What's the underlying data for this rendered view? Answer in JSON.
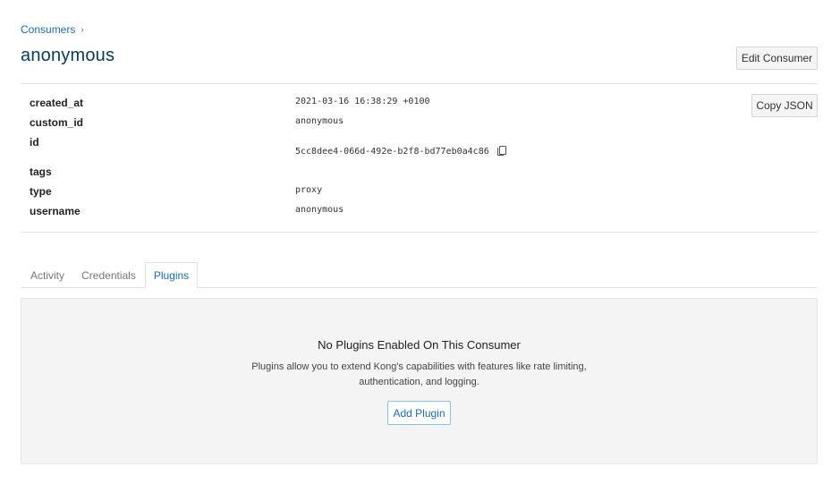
{
  "breadcrumb": {
    "parent": "Consumers",
    "separator": "›"
  },
  "title": "anonymous",
  "actions": {
    "edit_label": "Edit Consumer",
    "copy_json_label": "Copy JSON"
  },
  "details": [
    {
      "key": "created_at",
      "value": "2021-03-16 16:38:29 +0100"
    },
    {
      "key": "custom_id",
      "value": "anonymous"
    },
    {
      "key": "id",
      "value": "5cc8dee4-066d-492e-b2f8-bd77eb0a4c86",
      "copy_icon": "copy-icon"
    },
    {
      "key": "tags",
      "value": ""
    },
    {
      "key": "type",
      "value": "proxy"
    },
    {
      "key": "username",
      "value": "anonymous"
    }
  ],
  "tabs": [
    {
      "label": "Activity",
      "active": false
    },
    {
      "label": "Credentials",
      "active": false
    },
    {
      "label": "Plugins",
      "active": true
    }
  ],
  "empty_state": {
    "title": "No Plugins Enabled On This Consumer",
    "description_line1": "Plugins allow you to extend Kong's capabilities with features like rate limiting,",
    "description_line2": "authentication, and logging.",
    "button_label": "Add Plugin"
  },
  "colors": {
    "link": "#1a6fb5",
    "title": "#0b3c61",
    "panel_bg": "#f4f4f4"
  }
}
